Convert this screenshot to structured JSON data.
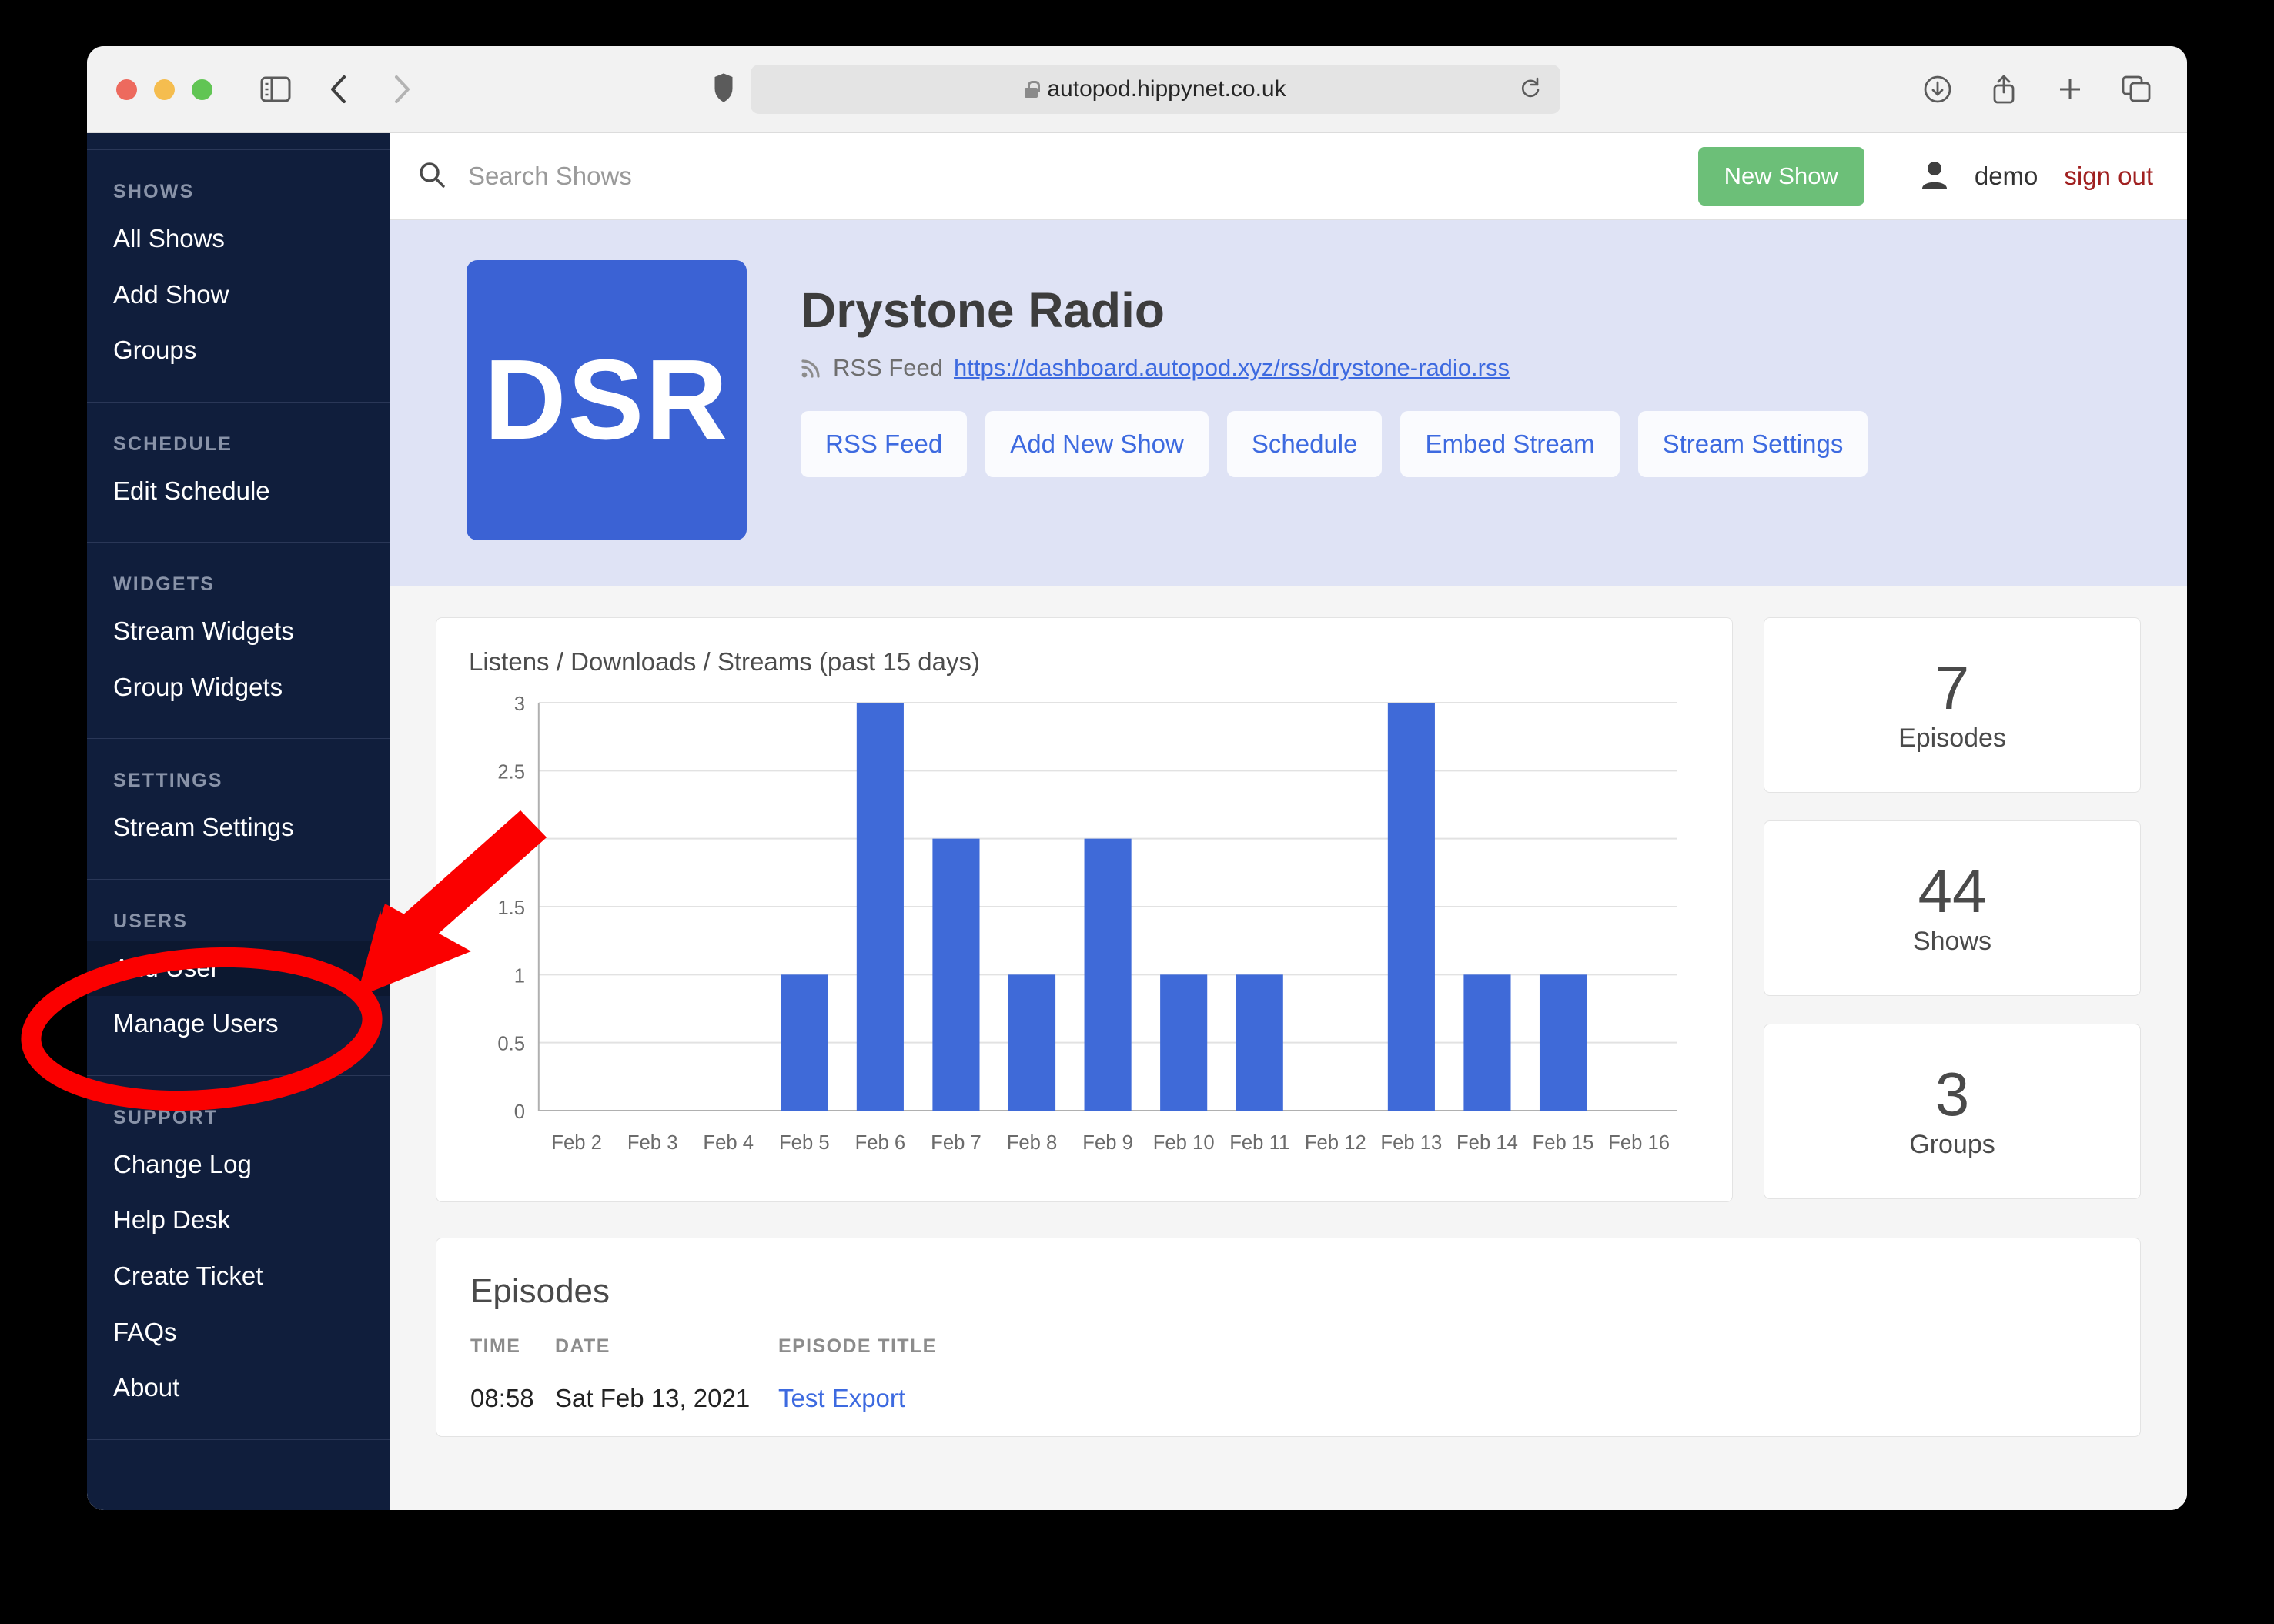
{
  "browser": {
    "url": "autopod.hippynet.co.uk",
    "icons": {
      "sidebar_toggle": "sidebar-toggle-icon",
      "back": "back-chevron-icon",
      "forward": "forward-chevron-icon",
      "shield": "privacy-shield-icon",
      "lock": "lock-icon",
      "reload": "reload-icon",
      "downloads": "downloads-icon",
      "share": "share-icon",
      "new_tab": "plus-icon",
      "tab_overview": "tab-overview-icon"
    }
  },
  "topbar": {
    "search_placeholder": "Search Shows",
    "search_value": "",
    "new_show_label": "New Show",
    "user_name": "demo",
    "sign_out_label": "sign out"
  },
  "sidebar": {
    "groups": [
      {
        "heading": "SHOWS",
        "items": [
          {
            "label": "All Shows"
          },
          {
            "label": "Add Show"
          },
          {
            "label": "Groups"
          }
        ]
      },
      {
        "heading": "SCHEDULE",
        "items": [
          {
            "label": "Edit Schedule"
          }
        ]
      },
      {
        "heading": "WIDGETS",
        "items": [
          {
            "label": "Stream Widgets"
          },
          {
            "label": "Group Widgets"
          }
        ]
      },
      {
        "heading": "SETTINGS",
        "items": [
          {
            "label": "Stream Settings"
          }
        ]
      },
      {
        "heading": "USERS",
        "items": [
          {
            "label": "Add User",
            "hovered": true
          },
          {
            "label": "Manage Users"
          }
        ]
      },
      {
        "heading": "SUPPORT",
        "items": [
          {
            "label": "Change Log"
          },
          {
            "label": "Help Desk"
          },
          {
            "label": "Create Ticket"
          },
          {
            "label": "FAQs"
          },
          {
            "label": "About"
          }
        ]
      }
    ]
  },
  "hero": {
    "logo_text": "DSR",
    "title": "Drystone Radio",
    "rss_label": "RSS Feed",
    "rss_url": "https://dashboard.autopod.xyz/rss/drystone-radio.rss",
    "chips": [
      {
        "label": "RSS Feed"
      },
      {
        "label": "Add New Show"
      },
      {
        "label": "Schedule"
      },
      {
        "label": "Embed Stream"
      },
      {
        "label": "Stream Settings"
      }
    ]
  },
  "stats": [
    {
      "value": "7",
      "label": "Episodes"
    },
    {
      "value": "44",
      "label": "Shows"
    },
    {
      "value": "3",
      "label": "Groups"
    }
  ],
  "episodes": {
    "title": "Episodes",
    "columns": [
      "TIME",
      "DATE",
      "EPISODE TITLE"
    ],
    "rows": [
      {
        "time": "08:58",
        "date": "Sat Feb 13, 2021",
        "title": "Test Export"
      }
    ]
  },
  "annotation": {
    "color": "#fb0000",
    "target_label": "Add User",
    "shapes": [
      "ellipse-highlight",
      "arrow-pointer"
    ]
  },
  "colors": {
    "sidebar_bg": "#101e3c",
    "hero_bg": "#dfe3f5",
    "brand_blue": "#3b62d4",
    "bar_blue": "#3f6ad8",
    "accent_green": "#6cbf78",
    "sign_out_red": "#a02020",
    "link_blue": "#3d6ae0",
    "annotation_red": "#fb0000"
  },
  "chart_data": {
    "type": "bar",
    "title": "Listens / Downloads / Streams (past 15 days)",
    "xlabel": "",
    "ylabel": "",
    "categories": [
      "Feb 2",
      "Feb 3",
      "Feb 4",
      "Feb 5",
      "Feb 6",
      "Feb 7",
      "Feb 8",
      "Feb 9",
      "Feb 10",
      "Feb 11",
      "Feb 12",
      "Feb 13",
      "Feb 14",
      "Feb 15",
      "Feb 16"
    ],
    "values": [
      0,
      0,
      0,
      1,
      3,
      2,
      1,
      2,
      1,
      1,
      0,
      3,
      1,
      1,
      0
    ],
    "yticks": [
      "0",
      "0.5",
      "1",
      "1.5",
      "2",
      "2.5",
      "3"
    ],
    "ylim": [
      0,
      3
    ],
    "grid": true,
    "legend": false,
    "series_color": "#3f6ad8"
  }
}
